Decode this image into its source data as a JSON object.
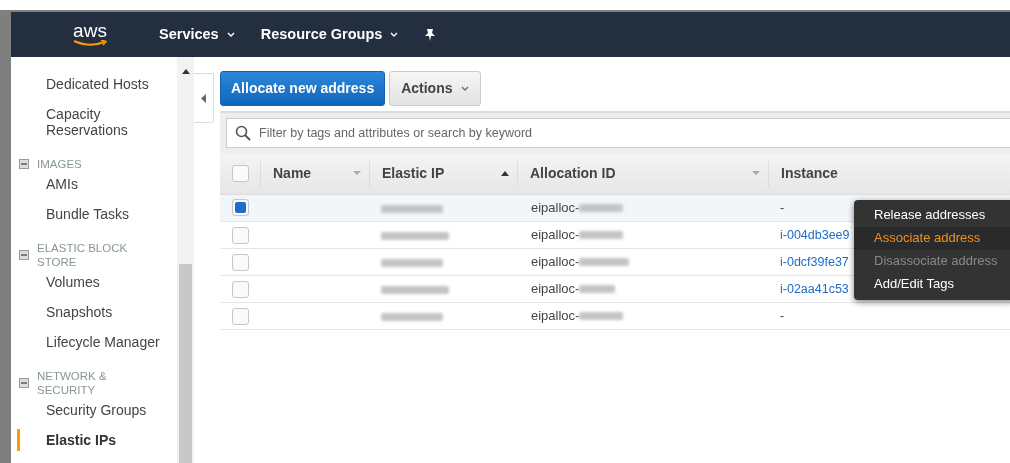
{
  "navbar": {
    "logo": "aws",
    "menus": [
      {
        "label": "Services"
      },
      {
        "label": "Resource Groups"
      }
    ]
  },
  "sidebar": {
    "items": [
      {
        "kind": "link",
        "label": "Dedicated Hosts",
        "selected": false
      },
      {
        "kind": "link",
        "label": "Capacity Reservations",
        "selected": false
      },
      {
        "kind": "section",
        "label": "IMAGES",
        "expanded": true
      },
      {
        "kind": "link",
        "label": "AMIs",
        "selected": false
      },
      {
        "kind": "link",
        "label": "Bundle Tasks",
        "selected": false
      },
      {
        "kind": "section",
        "label": "ELASTIC BLOCK STORE",
        "expanded": true
      },
      {
        "kind": "link",
        "label": "Volumes",
        "selected": false
      },
      {
        "kind": "link",
        "label": "Snapshots",
        "selected": false
      },
      {
        "kind": "link",
        "label": "Lifecycle Manager",
        "selected": false
      },
      {
        "kind": "section",
        "label": "NETWORK & SECURITY",
        "expanded": true
      },
      {
        "kind": "link",
        "label": "Security Groups",
        "selected": false
      },
      {
        "kind": "link",
        "label": "Elastic IPs",
        "selected": true
      }
    ]
  },
  "toolbar": {
    "primary_button": "Allocate new address",
    "actions_button": "Actions"
  },
  "search": {
    "placeholder": "Filter by tags and attributes or search by keyword"
  },
  "table": {
    "all_selected": false,
    "columns": [
      {
        "label": "Name",
        "sorted": false
      },
      {
        "label": "Elastic IP",
        "sorted": true
      },
      {
        "label": "Allocation ID",
        "sorted": false
      },
      {
        "label": "Instance"
      }
    ],
    "rows": [
      {
        "selected": true,
        "allocation_id": "eipalloc-",
        "instance": {
          "text": "-",
          "link": false
        }
      },
      {
        "selected": false,
        "allocation_id": "eipalloc-",
        "instance": {
          "text": "i-004db3ee9",
          "link": true
        }
      },
      {
        "selected": false,
        "allocation_id": "eipalloc-",
        "instance": {
          "text": "i-0dcf39fe37",
          "link": true
        }
      },
      {
        "selected": false,
        "allocation_id": "eipalloc-",
        "instance": {
          "text": "i-02aa41c53",
          "link": true
        }
      },
      {
        "selected": false,
        "allocation_id": "eipalloc-",
        "instance": {
          "text": "-",
          "link": false
        }
      }
    ]
  },
  "context_menu": {
    "items": [
      {
        "label": "Release addresses",
        "highlighted": false,
        "disabled": false
      },
      {
        "label": "Associate address",
        "highlighted": true,
        "disabled": false
      },
      {
        "label": "Disassociate address",
        "highlighted": false,
        "disabled": true
      },
      {
        "label": "Add/Edit Tags",
        "highlighted": false,
        "disabled": false
      }
    ]
  }
}
